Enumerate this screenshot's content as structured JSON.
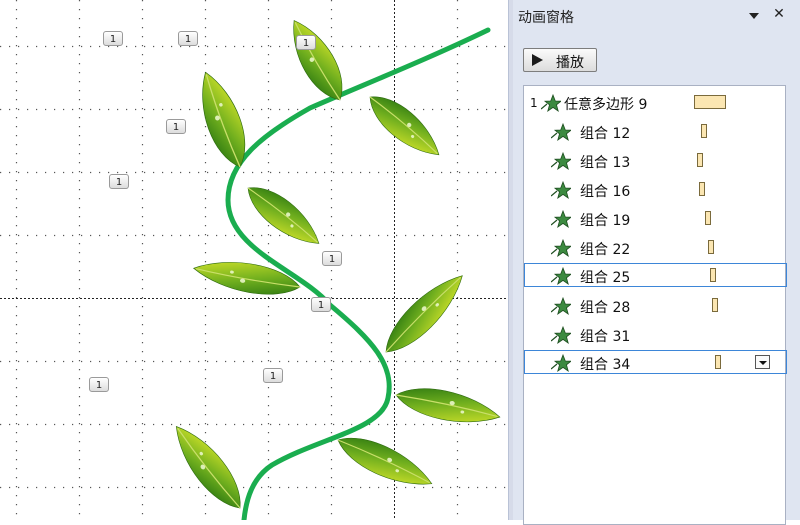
{
  "slide": {
    "trigger_tag_text": "1"
  },
  "pane": {
    "title": "动画窗格",
    "menu_icon": "triangle-down-icon",
    "close_icon": "close-icon",
    "play_button": {
      "label": "播放",
      "icon": "play-icon"
    },
    "items": [
      {
        "index": "1",
        "label": "任意多边形 9",
        "selected": false,
        "dropdown": false
      },
      {
        "index": "",
        "label": "组合 12",
        "selected": false,
        "dropdown": false
      },
      {
        "index": "",
        "label": "组合 13",
        "selected": false,
        "dropdown": false
      },
      {
        "index": "",
        "label": "组合 16",
        "selected": false,
        "dropdown": false
      },
      {
        "index": "",
        "label": "组合 19",
        "selected": false,
        "dropdown": false
      },
      {
        "index": "",
        "label": "组合 22",
        "selected": false,
        "dropdown": false
      },
      {
        "index": "",
        "label": "组合 25",
        "selected": true,
        "dropdown": false
      },
      {
        "index": "",
        "label": "组合 28",
        "selected": false,
        "dropdown": false
      },
      {
        "index": "",
        "label": "组合 31",
        "selected": false,
        "dropdown": false
      },
      {
        "index": "",
        "label": "组合 34",
        "selected": true,
        "dropdown": true
      }
    ]
  },
  "colors": {
    "vine": "#1aad4f",
    "leaf_dark": "#2d7d12",
    "leaf_light": "#d6e626",
    "pane_bg": "#dfe5f1",
    "timing_bar": "#fbe6b2",
    "selection": "#3d86d8"
  }
}
